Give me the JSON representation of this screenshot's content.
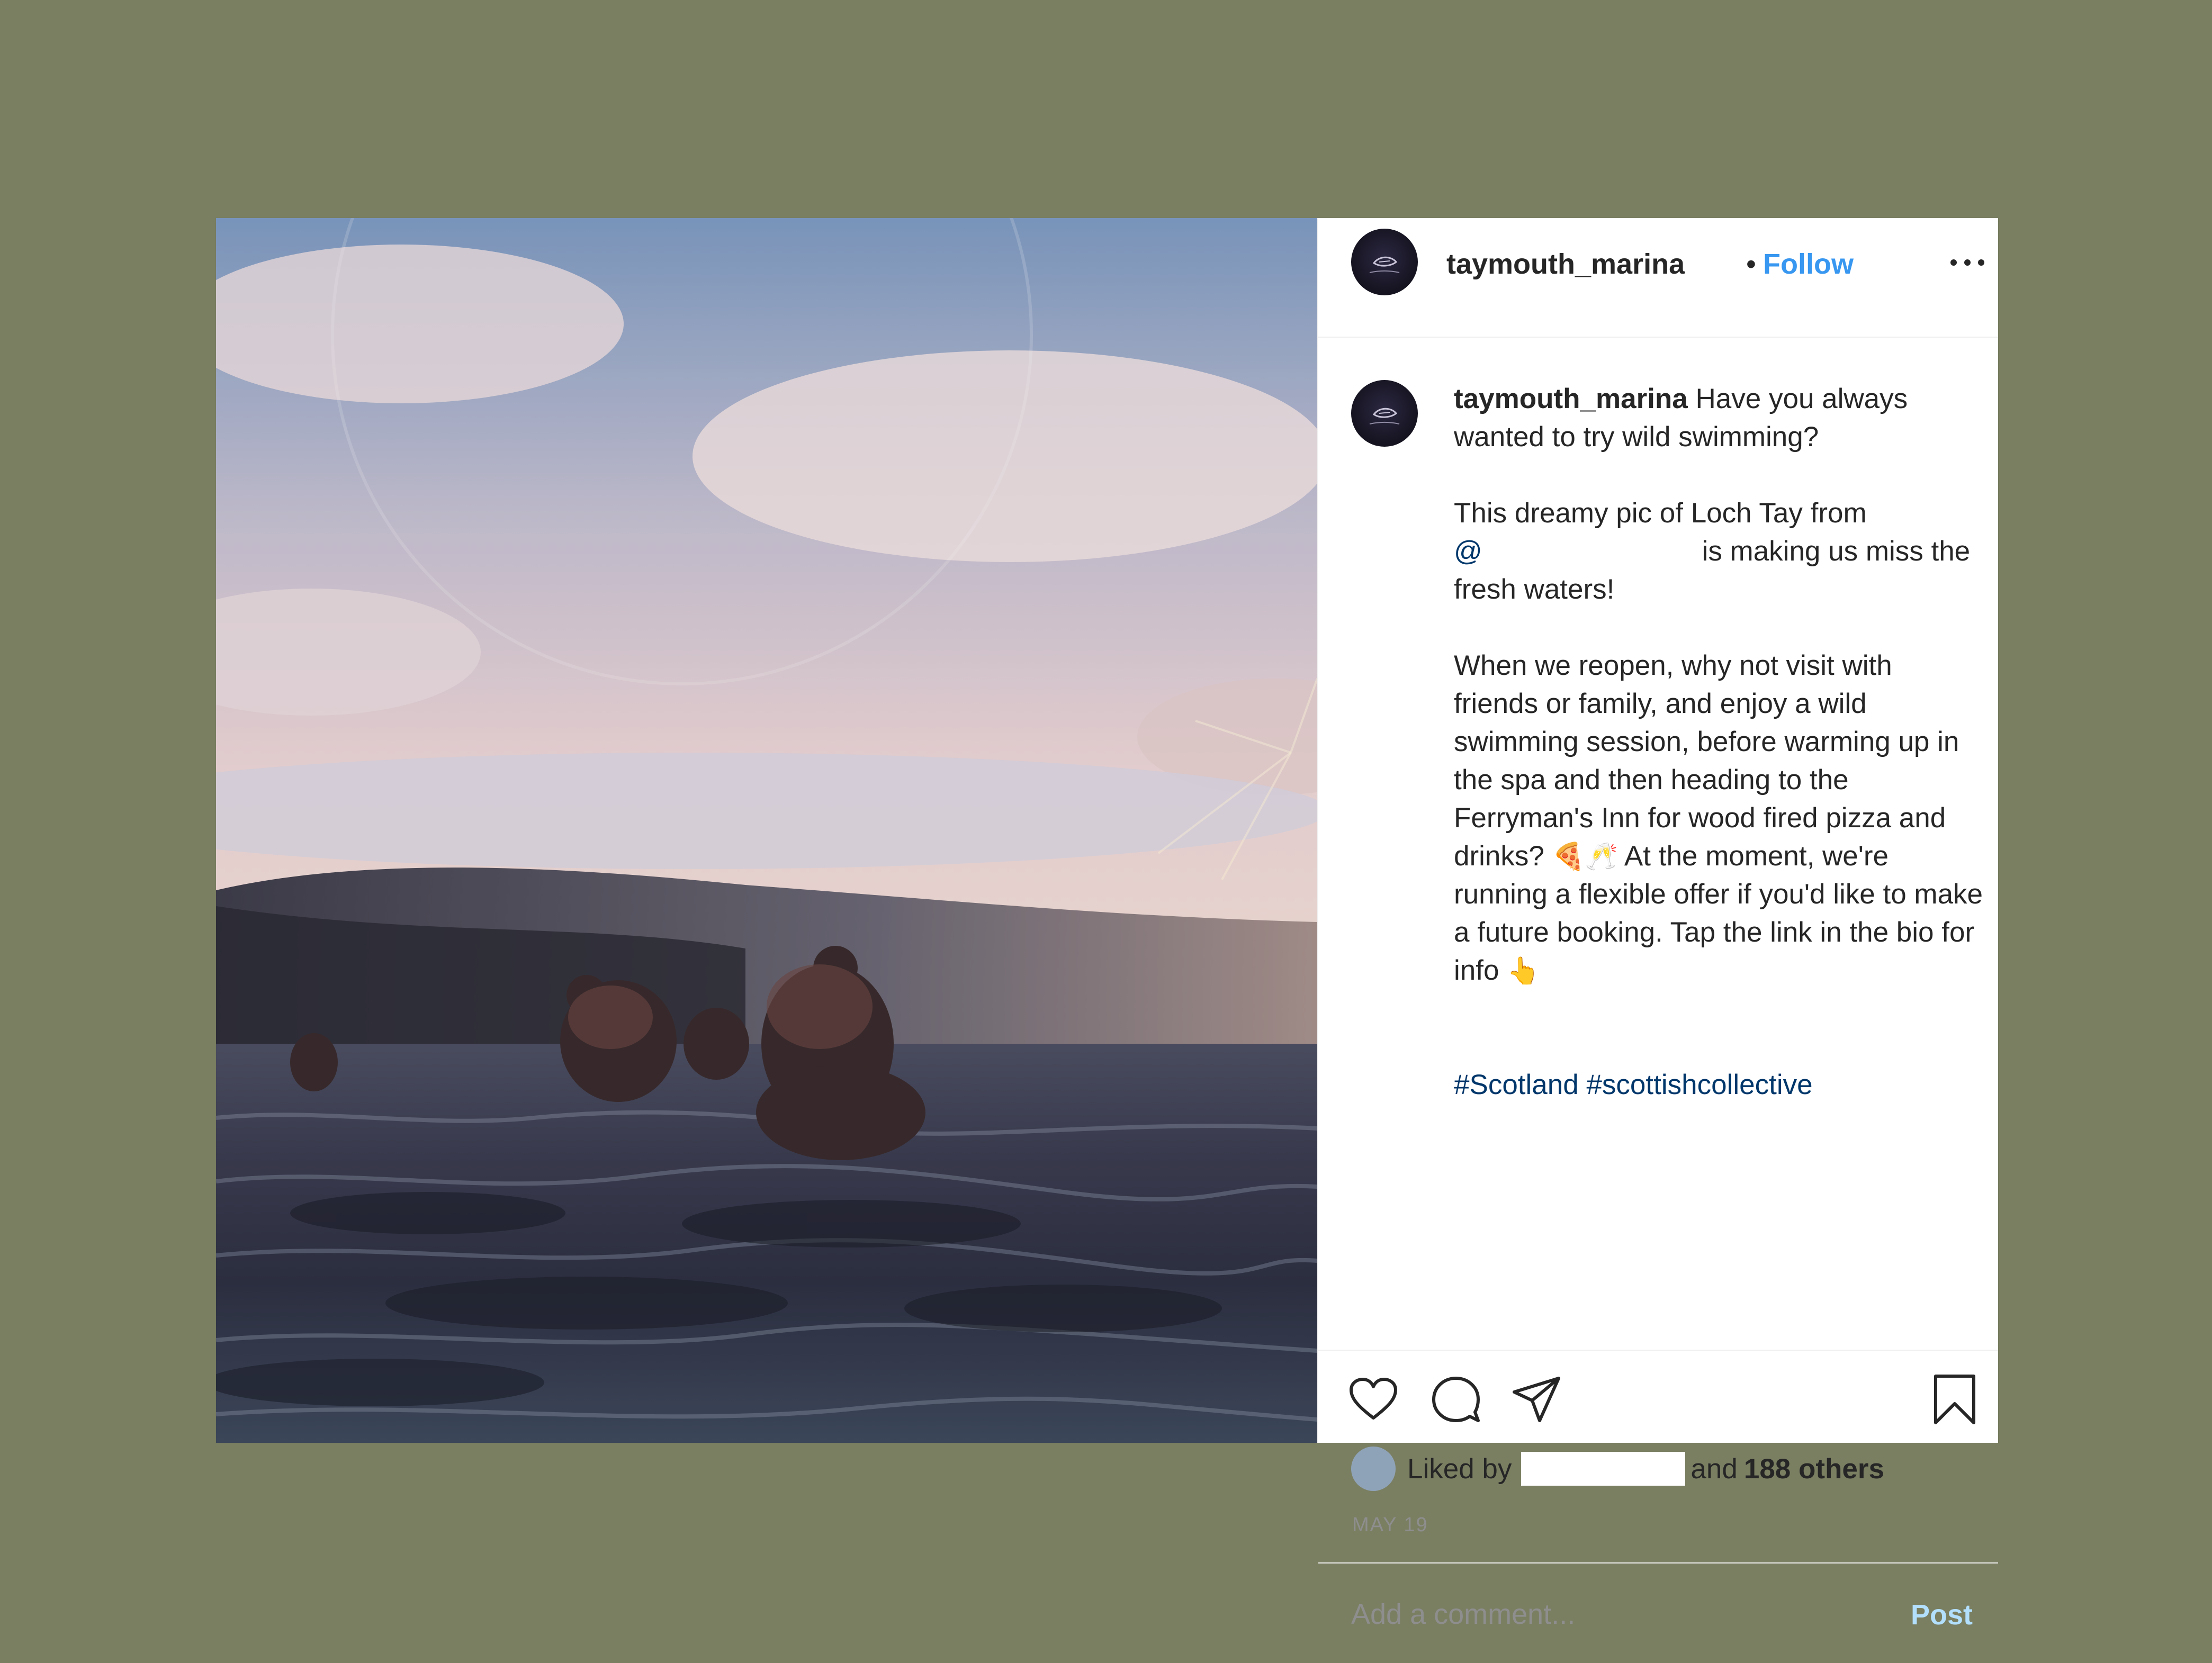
{
  "colors": {
    "background": "#7a7f62",
    "accent": "#3897f0",
    "link": "#00376b",
    "post_disabled": "#b2dffc",
    "muted_text": "#8e8e8e"
  },
  "header": {
    "username": "taymouth_marina",
    "separator": "•",
    "follow_label": "Follow",
    "more_icon": "more-horizontal-icon"
  },
  "caption": {
    "username": "taymouth_marina",
    "line1": "Have you always wanted to try wild swimming?",
    "para2_start": "This dreamy pic of Loch Tay from",
    "mention": "@",
    "para2_end": "is making us miss the fresh waters!",
    "para3_part1": "When we reopen, why not visit with friends or family, and enjoy a wild swimming session, before warming up in the spa and then heading to the Ferryman's Inn for wood fired pizza and drinks?",
    "emojis_1": "🍕🥂",
    "para3_part2": "At the moment, we're running a flexible offer if you'd like to make a future booking. Tap the link in the bio for info",
    "emoji_2": "👆",
    "hashtags": "#Scotland #scottishcollective"
  },
  "actions": {
    "like_icon": "heart-icon",
    "comment_icon": "comment-icon",
    "share_icon": "paper-plane-icon",
    "save_icon": "bookmark-icon"
  },
  "likes": {
    "liked_by_label": "Liked by",
    "and_label": "and",
    "count_label": "188 others"
  },
  "date": "MAY 19",
  "comment": {
    "placeholder": "Add a comment...",
    "post_label": "Post"
  }
}
